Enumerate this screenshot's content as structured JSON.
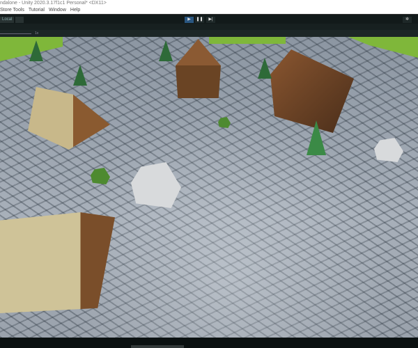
{
  "window": {
    "title": "ndalone - Unity 2020.3.17f1c1 Personal* <DX11>"
  },
  "menu": [
    "Store Tools",
    "Tutorial",
    "Window",
    "Help"
  ],
  "toolbar": {
    "local_label": "Local",
    "play_icon": "▶",
    "pause_icon": "❚❚",
    "step_icon": "▶|",
    "settings_icon": "✲"
  },
  "game_view": {
    "scale_label": "1x"
  }
}
